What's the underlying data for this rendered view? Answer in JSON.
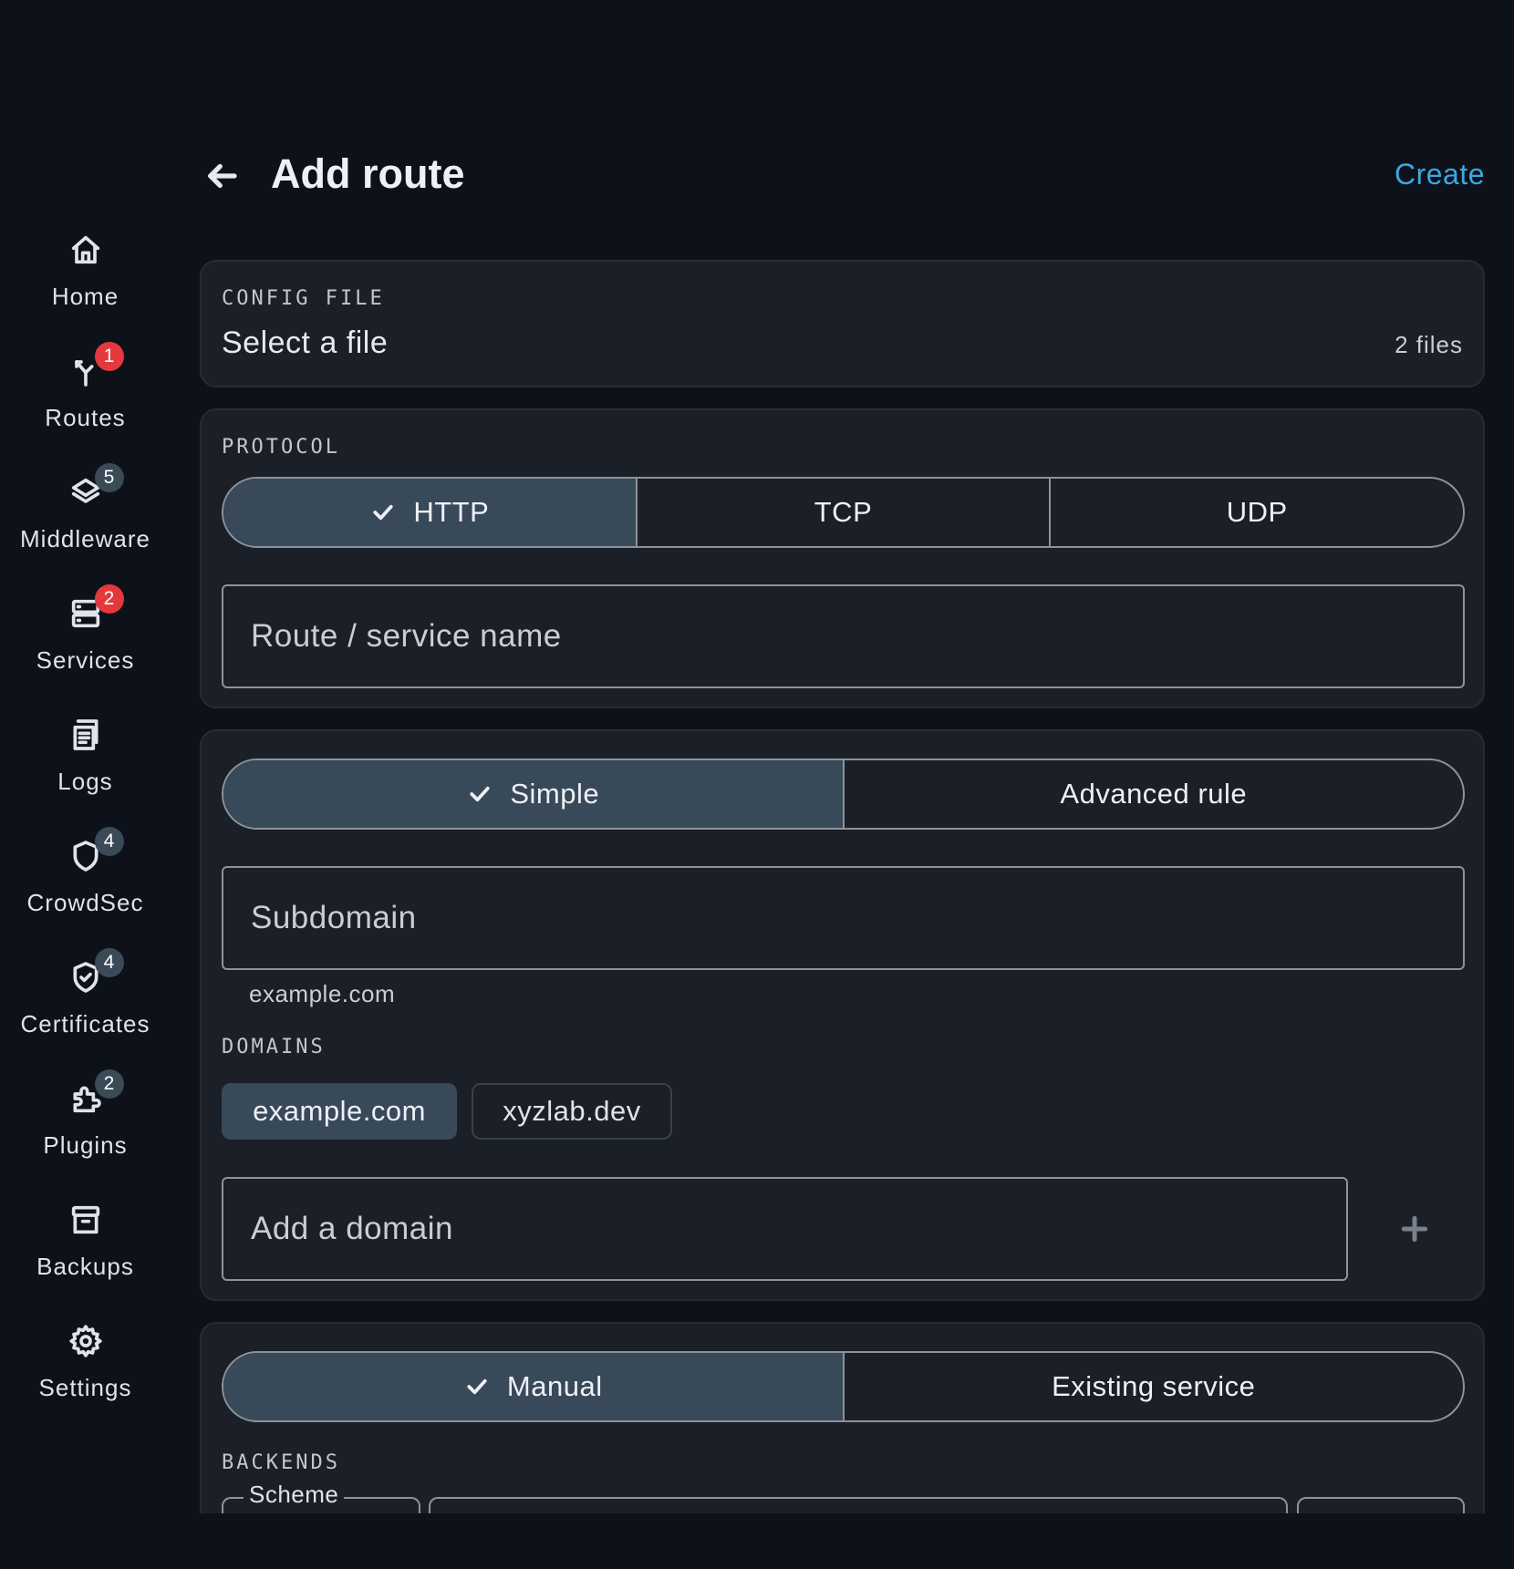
{
  "header": {
    "title": "Add route",
    "create_label": "Create"
  },
  "sidebar": {
    "items": [
      {
        "label": "Home",
        "icon": "home-icon",
        "badge": null
      },
      {
        "label": "Routes",
        "icon": "routes-icon",
        "badge": "1",
        "badge_color": "#e5383b"
      },
      {
        "label": "Middleware",
        "icon": "layers-icon",
        "badge": "5",
        "badge_color": "#3a4a56"
      },
      {
        "label": "Services",
        "icon": "server-icon",
        "badge": "2",
        "badge_color": "#e5383b"
      },
      {
        "label": "Logs",
        "icon": "logs-icon",
        "badge": null
      },
      {
        "label": "CrowdSec",
        "icon": "shield-icon",
        "badge": "4",
        "badge_color": "#3a4a56"
      },
      {
        "label": "Certificates",
        "icon": "shield-check-icon",
        "badge": "4",
        "badge_color": "#3a4a56"
      },
      {
        "label": "Plugins",
        "icon": "puzzle-icon",
        "badge": "2",
        "badge_color": "#3a4a56"
      },
      {
        "label": "Backups",
        "icon": "archive-icon",
        "badge": null
      },
      {
        "label": "Settings",
        "icon": "gear-icon",
        "badge": null
      }
    ]
  },
  "config_file": {
    "label": "CONFIG FILE",
    "value": "Select a file",
    "count": "2 files"
  },
  "protocol": {
    "label": "PROTOCOL",
    "options": [
      "HTTP",
      "TCP",
      "UDP"
    ],
    "selected": "HTTP",
    "name_placeholder": "Route / service name"
  },
  "rule": {
    "modes": [
      "Simple",
      "Advanced rule"
    ],
    "selected": "Simple",
    "subdomain_placeholder": "Subdomain",
    "subdomain_helper": "example.com",
    "domains_label": "DOMAINS",
    "domains": [
      "example.com",
      "xyzlab.dev"
    ],
    "selected_domain": "example.com",
    "add_domain_placeholder": "Add a domain"
  },
  "backend": {
    "modes": [
      "Manual",
      "Existing service"
    ],
    "selected": "Manual",
    "backends_label": "BACKENDS",
    "scheme_label": "Scheme"
  },
  "colors": {
    "background": "#0d111a",
    "card": "#1b1f27",
    "accent": "#3ea6e0",
    "active_segment": "#38495a",
    "badge_red": "#e5383b",
    "badge_gray": "#3a4a56"
  }
}
